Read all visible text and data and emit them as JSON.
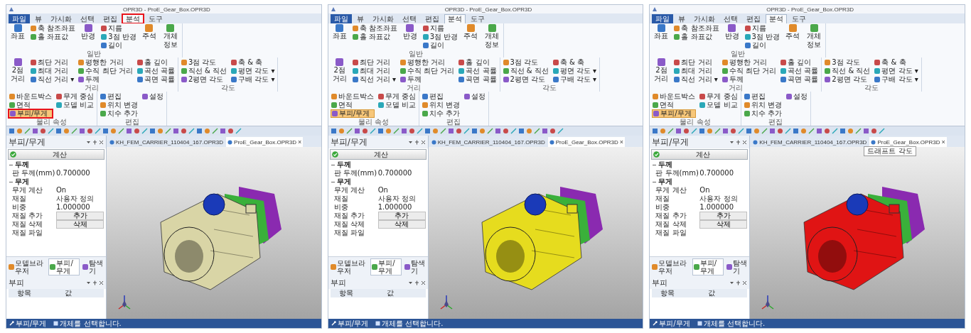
{
  "panels": [
    {
      "window": {
        "title": "OPR3D - ProE_Gear_Box.OPR3D"
      },
      "highlight_outlines": true,
      "color": "#d9d5a6",
      "tabs": [
        {
          "label": "파일",
          "kind": "file",
          "selected": false
        },
        {
          "label": "뷰",
          "kind": "tab",
          "selected": false
        },
        {
          "label": "가시화",
          "kind": "tab",
          "selected": false
        },
        {
          "label": "선택",
          "kind": "tab",
          "selected": false
        },
        {
          "label": "편집",
          "kind": "tab",
          "selected": false
        },
        {
          "label": "분석",
          "kind": "tab",
          "selected": true
        },
        {
          "label": "도구",
          "kind": "tab",
          "selected": false
        }
      ],
      "ribbon": [
        {
          "label": "일반",
          "items": [
            {
              "label": "좌표",
              "kind": "large",
              "selected": false
            },
            {
              "label": "축 참조좌표",
              "kind": "small",
              "selected": false
            },
            {
              "label": "홀 좌표값",
              "kind": "small",
              "selected": false
            },
            {
              "label": "반경",
              "kind": "large",
              "selected": false
            },
            {
              "label": "지름",
              "kind": "small",
              "selected": false
            },
            {
              "label": "3점 반경",
              "kind": "small",
              "selected": false
            },
            {
              "label": "길이",
              "kind": "small",
              "selected": false
            },
            {
              "label": "주석",
              "kind": "large",
              "selected": false
            },
            {
              "label": "개체 정보",
              "kind": "large",
              "selected": false
            }
          ]
        },
        {
          "label": "거리",
          "items": [
            {
              "label": "2점 거리",
              "kind": "large",
              "selected": false
            },
            {
              "label": "최단 거리",
              "kind": "small",
              "selected": false
            },
            {
              "label": "최대 거리",
              "kind": "small",
              "selected": false
            },
            {
              "label": "직선 거리 ▾",
              "kind": "small",
              "selected": false
            },
            {
              "label": "평행한 거리",
              "kind": "small",
              "selected": false
            },
            {
              "label": "수직 최단 거리",
              "kind": "small",
              "selected": false
            },
            {
              "label": "두께",
              "kind": "small",
              "selected": false
            },
            {
              "label": "홀 깊이",
              "kind": "small",
              "selected": false
            },
            {
              "label": "곡선 곡률",
              "kind": "small",
              "selected": false
            },
            {
              "label": "곡면 곡률",
              "kind": "small",
              "selected": false
            }
          ]
        },
        {
          "label": "각도",
          "items": [
            {
              "label": "3점 각도",
              "kind": "small",
              "selected": false
            },
            {
              "label": "직선 & 직선",
              "kind": "small",
              "selected": false
            },
            {
              "label": "2평면 각도",
              "kind": "small",
              "selected": false
            },
            {
              "label": "축 & 축",
              "kind": "small",
              "selected": false
            },
            {
              "label": "평면 각도 ▾",
              "kind": "small",
              "selected": false
            },
            {
              "label": "구배 각도 ▾",
              "kind": "small",
              "selected": false
            }
          ]
        },
        {
          "label": "물리 속성",
          "items": [
            {
              "label": "바운드박스",
              "kind": "small",
              "selected": false
            },
            {
              "label": "면적",
              "kind": "small",
              "selected": false
            },
            {
              "label": "부피/무게",
              "kind": "small",
              "selected": true
            },
            {
              "label": "무게 중심",
              "kind": "small",
              "selected": false
            },
            {
              "label": "모델 비교",
              "kind": "small",
              "selected": false
            }
          ]
        },
        {
          "label": "편집",
          "items": [
            {
              "label": "편집",
              "kind": "small",
              "selected": false
            },
            {
              "label": "위치 변경",
              "kind": "small",
              "selected": false
            },
            {
              "label": "치수 추가",
              "kind": "small",
              "selected": false
            },
            {
              "label": "설정",
              "kind": "small",
              "selected": false
            }
          ]
        }
      ],
      "documents": [
        {
          "label": "KH_FEM_CARRIER_110404_167.OPR3D",
          "selected": false
        },
        {
          "label": "ProE_Gear_Box.OPR3D",
          "selected": true
        }
      ],
      "close_glyph": "×",
      "side_panel": {
        "title": "부피/무게",
        "calc_button": "계산",
        "rows": [
          {
            "kind": "section",
            "label": "두께"
          },
          {
            "kind": "value",
            "label": "판 두께(mm)",
            "value": "0.700000"
          },
          {
            "kind": "section",
            "label": "무게"
          },
          {
            "kind": "value",
            "label": "무게 계산",
            "value": "On"
          },
          {
            "kind": "value",
            "label": "재질",
            "value": "사용자 정의"
          },
          {
            "kind": "value",
            "label": "비중",
            "value": "1.000000"
          },
          {
            "kind": "button",
            "label": "재질 추가",
            "value": "추가"
          },
          {
            "kind": "button",
            "label": "재질 삭제",
            "value": "삭제"
          },
          {
            "kind": "value",
            "label": "재질 파일"
          }
        ]
      },
      "bottom_tabs": [
        {
          "label": "모델브라우저",
          "selected": false
        },
        {
          "label": "부피/무게",
          "selected": true
        },
        {
          "label": "탐색기",
          "selected": false
        }
      ],
      "bottom_panel": {
        "title": "부피",
        "columns": [
          "항목",
          "값"
        ]
      },
      "status_bar": [
        "부피/무게",
        "개체를 선택합니다."
      ]
    },
    {
      "window": {
        "title": "OPR3D - ProE_Gear_Box.OPR3D"
      },
      "highlight_outlines": false,
      "color": "#e6dc1e",
      "tabs": [
        {
          "label": "파일",
          "kind": "file",
          "selected": false
        },
        {
          "label": "뷰",
          "kind": "tab",
          "selected": false
        },
        {
          "label": "가시화",
          "kind": "tab",
          "selected": false
        },
        {
          "label": "선택",
          "kind": "tab",
          "selected": false
        },
        {
          "label": "편집",
          "kind": "tab",
          "selected": false
        },
        {
          "label": "분석",
          "kind": "tab",
          "selected": true
        },
        {
          "label": "도구",
          "kind": "tab",
          "selected": false
        }
      ],
      "ribbon": [
        {
          "label": "일반",
          "items": [
            {
              "label": "좌표",
              "kind": "large",
              "selected": false
            },
            {
              "label": "축 참조좌표",
              "kind": "small",
              "selected": false
            },
            {
              "label": "홀 좌표값",
              "kind": "small",
              "selected": false
            },
            {
              "label": "반경",
              "kind": "large",
              "selected": false
            },
            {
              "label": "지름",
              "kind": "small",
              "selected": false
            },
            {
              "label": "3점 반경",
              "kind": "small",
              "selected": false
            },
            {
              "label": "길이",
              "kind": "small",
              "selected": false
            },
            {
              "label": "주석",
              "kind": "large",
              "selected": false
            },
            {
              "label": "개체 정보",
              "kind": "large",
              "selected": false
            }
          ]
        },
        {
          "label": "거리",
          "items": [
            {
              "label": "2점 거리",
              "kind": "large",
              "selected": false
            },
            {
              "label": "최단 거리",
              "kind": "small",
              "selected": false
            },
            {
              "label": "최대 거리",
              "kind": "small",
              "selected": false
            },
            {
              "label": "직선 거리 ▾",
              "kind": "small",
              "selected": false
            },
            {
              "label": "평행한 거리",
              "kind": "small",
              "selected": false
            },
            {
              "label": "수직 최단 거리",
              "kind": "small",
              "selected": false
            },
            {
              "label": "두께",
              "kind": "small",
              "selected": false
            },
            {
              "label": "홀 깊이",
              "kind": "small",
              "selected": false
            },
            {
              "label": "곡선 곡률",
              "kind": "small",
              "selected": false
            },
            {
              "label": "곡면 곡률",
              "kind": "small",
              "selected": false
            }
          ]
        },
        {
          "label": "각도",
          "items": [
            {
              "label": "3점 각도",
              "kind": "small",
              "selected": false
            },
            {
              "label": "직선 & 직선",
              "kind": "small",
              "selected": false
            },
            {
              "label": "2평면 각도",
              "kind": "small",
              "selected": false
            },
            {
              "label": "축 & 축",
              "kind": "small",
              "selected": false
            },
            {
              "label": "평면 각도 ▾",
              "kind": "small",
              "selected": false
            },
            {
              "label": "구배 각도 ▾",
              "kind": "small",
              "selected": false
            }
          ]
        },
        {
          "label": "물리 속성",
          "items": [
            {
              "label": "바운드박스",
              "kind": "small",
              "selected": false
            },
            {
              "label": "면적",
              "kind": "small",
              "selected": false
            },
            {
              "label": "부피/무게",
              "kind": "small",
              "selected": true
            },
            {
              "label": "무게 중심",
              "kind": "small",
              "selected": false
            },
            {
              "label": "모델 비교",
              "kind": "small",
              "selected": false
            }
          ]
        },
        {
          "label": "편집",
          "items": [
            {
              "label": "편집",
              "kind": "small",
              "selected": false
            },
            {
              "label": "위치 변경",
              "kind": "small",
              "selected": false
            },
            {
              "label": "치수 추가",
              "kind": "small",
              "selected": false
            },
            {
              "label": "설정",
              "kind": "small",
              "selected": false
            }
          ]
        }
      ],
      "documents": [
        {
          "label": "KH_FEM_CARRIER_110404_167.OPR3D",
          "selected": false
        },
        {
          "label": "ProE_Gear_Box.OPR3D",
          "selected": true
        }
      ],
      "close_glyph": "×",
      "side_panel": {
        "title": "부피/무게",
        "calc_button": "계산",
        "rows": [
          {
            "kind": "section",
            "label": "두께"
          },
          {
            "kind": "value",
            "label": "판 두께(mm)",
            "value": "0.700000"
          },
          {
            "kind": "section",
            "label": "무게"
          },
          {
            "kind": "value",
            "label": "무게 계산",
            "value": "On"
          },
          {
            "kind": "value",
            "label": "재질",
            "value": "사용자 정의"
          },
          {
            "kind": "value",
            "label": "비중",
            "value": "1.000000"
          },
          {
            "kind": "button",
            "label": "재질 추가",
            "value": "추가"
          },
          {
            "kind": "button",
            "label": "재질 삭제",
            "value": "삭제"
          },
          {
            "kind": "value",
            "label": "재질 파일"
          }
        ]
      },
      "bottom_tabs": [
        {
          "label": "모델브라우저",
          "selected": false
        },
        {
          "label": "부피/무게",
          "selected": true
        },
        {
          "label": "탐색기",
          "selected": false
        }
      ],
      "bottom_panel": {
        "title": "부피",
        "columns": [
          "항목",
          "값"
        ]
      },
      "status_bar": [
        "부피/무게",
        "개체를 선택합니다."
      ]
    },
    {
      "window": {
        "title": "OPR3D - ProE_Gear_Box.OPR3D"
      },
      "highlight_outlines": false,
      "color": "#e01414",
      "tooltip": "드래프트 각도",
      "tabs": [
        {
          "label": "파일",
          "kind": "file",
          "selected": false
        },
        {
          "label": "뷰",
          "kind": "tab",
          "selected": false
        },
        {
          "label": "가시화",
          "kind": "tab",
          "selected": false
        },
        {
          "label": "선택",
          "kind": "tab",
          "selected": false
        },
        {
          "label": "편집",
          "kind": "tab",
          "selected": false
        },
        {
          "label": "분석",
          "kind": "tab",
          "selected": true
        },
        {
          "label": "도구",
          "kind": "tab",
          "selected": false
        }
      ],
      "ribbon": [
        {
          "label": "일반",
          "items": [
            {
              "label": "좌표",
              "kind": "large",
              "selected": false
            },
            {
              "label": "축 참조좌표",
              "kind": "small",
              "selected": false
            },
            {
              "label": "홀 좌표값",
              "kind": "small",
              "selected": false
            },
            {
              "label": "반경",
              "kind": "large",
              "selected": false
            },
            {
              "label": "지름",
              "kind": "small",
              "selected": false
            },
            {
              "label": "3점 반경",
              "kind": "small",
              "selected": false
            },
            {
              "label": "길이",
              "kind": "small",
              "selected": false
            },
            {
              "label": "주석",
              "kind": "large",
              "selected": false
            },
            {
              "label": "개체 정보",
              "kind": "large",
              "selected": false
            }
          ]
        },
        {
          "label": "거리",
          "items": [
            {
              "label": "2점 거리",
              "kind": "large",
              "selected": false
            },
            {
              "label": "최단 거리",
              "kind": "small",
              "selected": false
            },
            {
              "label": "최대 거리",
              "kind": "small",
              "selected": false
            },
            {
              "label": "직선 거리 ▾",
              "kind": "small",
              "selected": false
            },
            {
              "label": "평행한 거리",
              "kind": "small",
              "selected": false
            },
            {
              "label": "수직 최단 거리",
              "kind": "small",
              "selected": false
            },
            {
              "label": "두께",
              "kind": "small",
              "selected": false
            },
            {
              "label": "홀 깊이",
              "kind": "small",
              "selected": false
            },
            {
              "label": "곡선 곡률",
              "kind": "small",
              "selected": false
            },
            {
              "label": "곡면 곡률",
              "kind": "small",
              "selected": false
            }
          ]
        },
        {
          "label": "각도",
          "items": [
            {
              "label": "3점 각도",
              "kind": "small",
              "selected": false
            },
            {
              "label": "직선 & 직선",
              "kind": "small",
              "selected": false
            },
            {
              "label": "2평면 각도",
              "kind": "small",
              "selected": false
            },
            {
              "label": "축 & 축",
              "kind": "small",
              "selected": false
            },
            {
              "label": "평면 각도 ▾",
              "kind": "small",
              "selected": false
            },
            {
              "label": "구배 각도 ▾",
              "kind": "small",
              "selected": false
            }
          ]
        },
        {
          "label": "물리 속성",
          "items": [
            {
              "label": "바운드박스",
              "kind": "small",
              "selected": false
            },
            {
              "label": "면적",
              "kind": "small",
              "selected": false
            },
            {
              "label": "부피/무게",
              "kind": "small",
              "selected": true
            },
            {
              "label": "무게 중심",
              "kind": "small",
              "selected": false
            },
            {
              "label": "모델 비교",
              "kind": "small",
              "selected": false
            }
          ]
        },
        {
          "label": "편집",
          "items": [
            {
              "label": "편집",
              "kind": "small",
              "selected": false
            },
            {
              "label": "위치 변경",
              "kind": "small",
              "selected": false
            },
            {
              "label": "치수 추가",
              "kind": "small",
              "selected": false
            },
            {
              "label": "설정",
              "kind": "small",
              "selected": false
            }
          ]
        }
      ],
      "documents": [
        {
          "label": "KH_FEM_CARRIER_110404_167.OPR3D",
          "selected": false
        },
        {
          "label": "ProE_Gear_Box.OPR3D",
          "selected": true
        }
      ],
      "close_glyph": "×",
      "side_panel": {
        "title": "부피/무게",
        "calc_button": "계산",
        "rows": [
          {
            "kind": "section",
            "label": "두께"
          },
          {
            "kind": "value",
            "label": "판 두께(mm)",
            "value": "0.700000"
          },
          {
            "kind": "section",
            "label": "무게"
          },
          {
            "kind": "value",
            "label": "무게 계산",
            "value": "On"
          },
          {
            "kind": "value",
            "label": "재질",
            "value": "사용자 정의"
          },
          {
            "kind": "value",
            "label": "비중",
            "value": "1.000000"
          },
          {
            "kind": "button",
            "label": "재질 추가",
            "value": "추가"
          },
          {
            "kind": "button",
            "label": "재질 삭제",
            "value": "삭제"
          },
          {
            "kind": "value",
            "label": "재질 파일"
          }
        ]
      },
      "bottom_tabs": [
        {
          "label": "모델브라우저",
          "selected": false
        },
        {
          "label": "부피/무게",
          "selected": true
        },
        {
          "label": "탐색기",
          "selected": false
        }
      ],
      "bottom_panel": {
        "title": "부피",
        "columns": [
          "항목",
          "값"
        ]
      },
      "status_bar": [
        "부피/무게",
        "개체를 선택합니다."
      ]
    }
  ]
}
